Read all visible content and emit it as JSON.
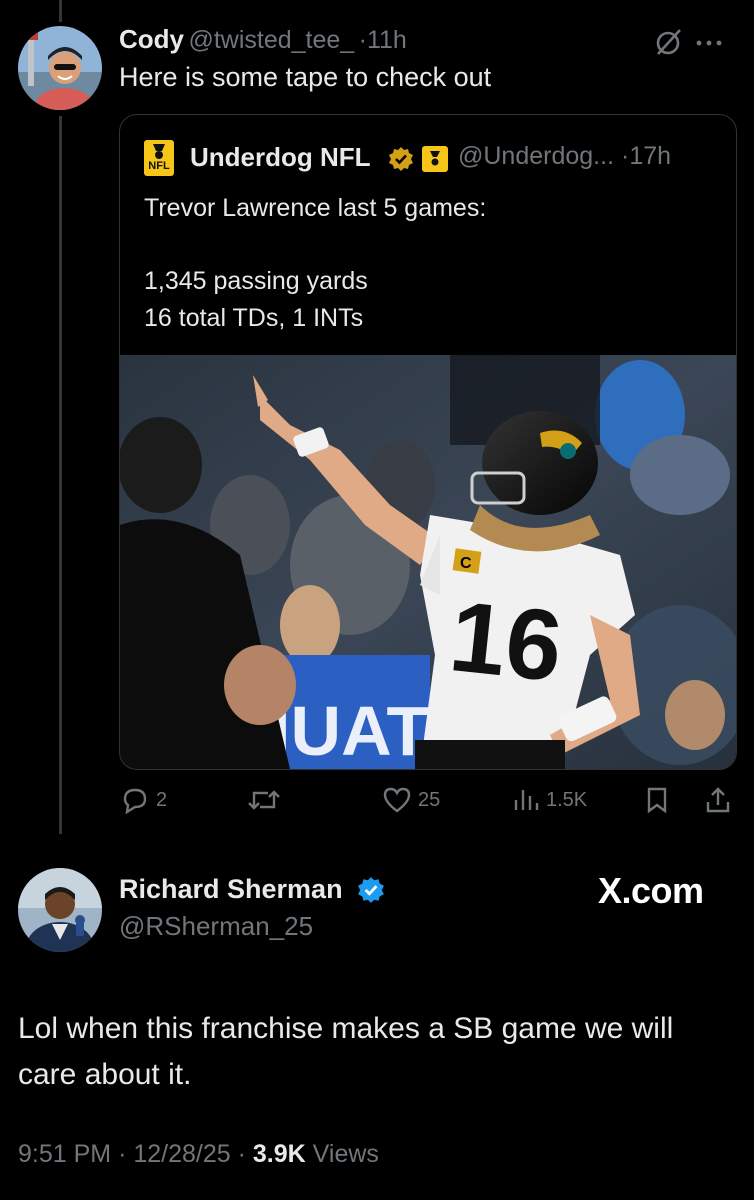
{
  "reply_tweet": {
    "author_name": "Cody",
    "author_handle": "@twisted_tee_",
    "separator": "·",
    "time": "11h",
    "text": "Here is some tape to check out",
    "more_icon": "more-dots-icon",
    "grok_icon": "grok-slash-icon"
  },
  "quoted_tweet": {
    "logo_line1": "NFL",
    "author_name": "Underdog NFL",
    "author_handle": "@Underdog...",
    "separator": "·",
    "time": "17h",
    "text_line1": "Trevor Lawrence last 5 games:",
    "text_line2": "1,345 passing yards",
    "text_line3": "16 total TDs, 1 INTs",
    "photo": {
      "jersey_number": "16",
      "captain_patch": "C"
    },
    "verified_color": "#d4a017"
  },
  "actions": {
    "replies": "2",
    "reposts": "",
    "likes": "25",
    "views": "1.5K"
  },
  "main_tweet": {
    "author_name": "Richard Sherman",
    "author_handle": "@RSherman_25",
    "watermark": "X.com",
    "text": "Lol when this franchise makes a SB game we will care about it.",
    "time": "9:51 PM",
    "separator": "·",
    "date": "12/28/25",
    "separator2": "·",
    "views_count": "3.9K",
    "views_label": "Views",
    "verified_color": "#1d9bf0"
  }
}
